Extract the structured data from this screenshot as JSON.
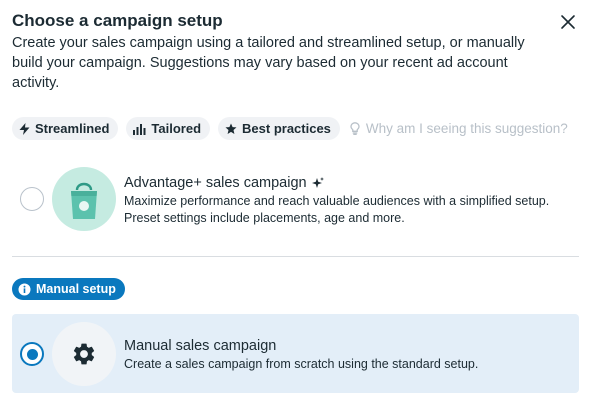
{
  "dialog": {
    "title": "Choose a campaign setup",
    "description": "Create your sales campaign using a tailored and streamlined setup, or manually build your campaign. Suggestions may vary based on your recent ad account activity."
  },
  "tags": [
    {
      "label": "Streamlined",
      "icon": "lightning-icon"
    },
    {
      "label": "Tailored",
      "icon": "bar-chart-icon"
    },
    {
      "label": "Best practices",
      "icon": "star-icon"
    }
  ],
  "why_link": "Why am I seeing this suggestion?",
  "advantage_option": {
    "title": "Advantage+ sales campaign",
    "description_line1": "Maximize performance and reach valuable audiences with a simplified setup.",
    "description_line2": "Preset settings include placements, age and more.",
    "selected": false,
    "icon": "shopping-bag-icon"
  },
  "manual_badge": "Manual setup",
  "manual_option": {
    "title": "Manual sales campaign",
    "description": "Create a sales campaign from scratch using the standard setup.",
    "selected": true,
    "icon": "gear-icon"
  },
  "colors": {
    "accent": "#0a78be",
    "selected_card_bg": "#e3eef8",
    "tag_bg": "#f0f2f5",
    "icon_teal": "#7fcdbb"
  }
}
